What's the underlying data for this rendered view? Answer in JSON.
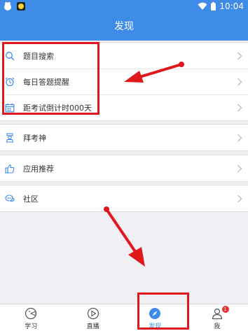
{
  "status_bar": {
    "time": "10:04"
  },
  "header": {
    "title": "发现"
  },
  "groups": [
    {
      "items": [
        {
          "label": "题目搜索",
          "icon": "search-icon"
        },
        {
          "label": "每日答题提醒",
          "icon": "alarm-clock-icon"
        },
        {
          "label": "距考试倒计时000天",
          "icon": "calendar-icon"
        }
      ]
    },
    {
      "items": [
        {
          "label": "拜考神",
          "icon": "god-idol-icon"
        }
      ]
    },
    {
      "items": [
        {
          "label": "应用推荐",
          "icon": "thumbs-up-icon"
        }
      ]
    },
    {
      "items": [
        {
          "label": "社区",
          "icon": "chat-bubble-icon"
        }
      ]
    }
  ],
  "tabbar": {
    "tabs": [
      {
        "label": "学习",
        "icon": "study-icon",
        "active": false
      },
      {
        "label": "直播",
        "icon": "play-icon",
        "active": false
      },
      {
        "label": "发现",
        "icon": "compass-icon",
        "active": true
      },
      {
        "label": "我",
        "icon": "person-icon",
        "active": false,
        "badge": "1"
      }
    ]
  },
  "colors": {
    "primary": "#3f8be8",
    "annotation": "#e0171b",
    "badge": "#f03030"
  }
}
